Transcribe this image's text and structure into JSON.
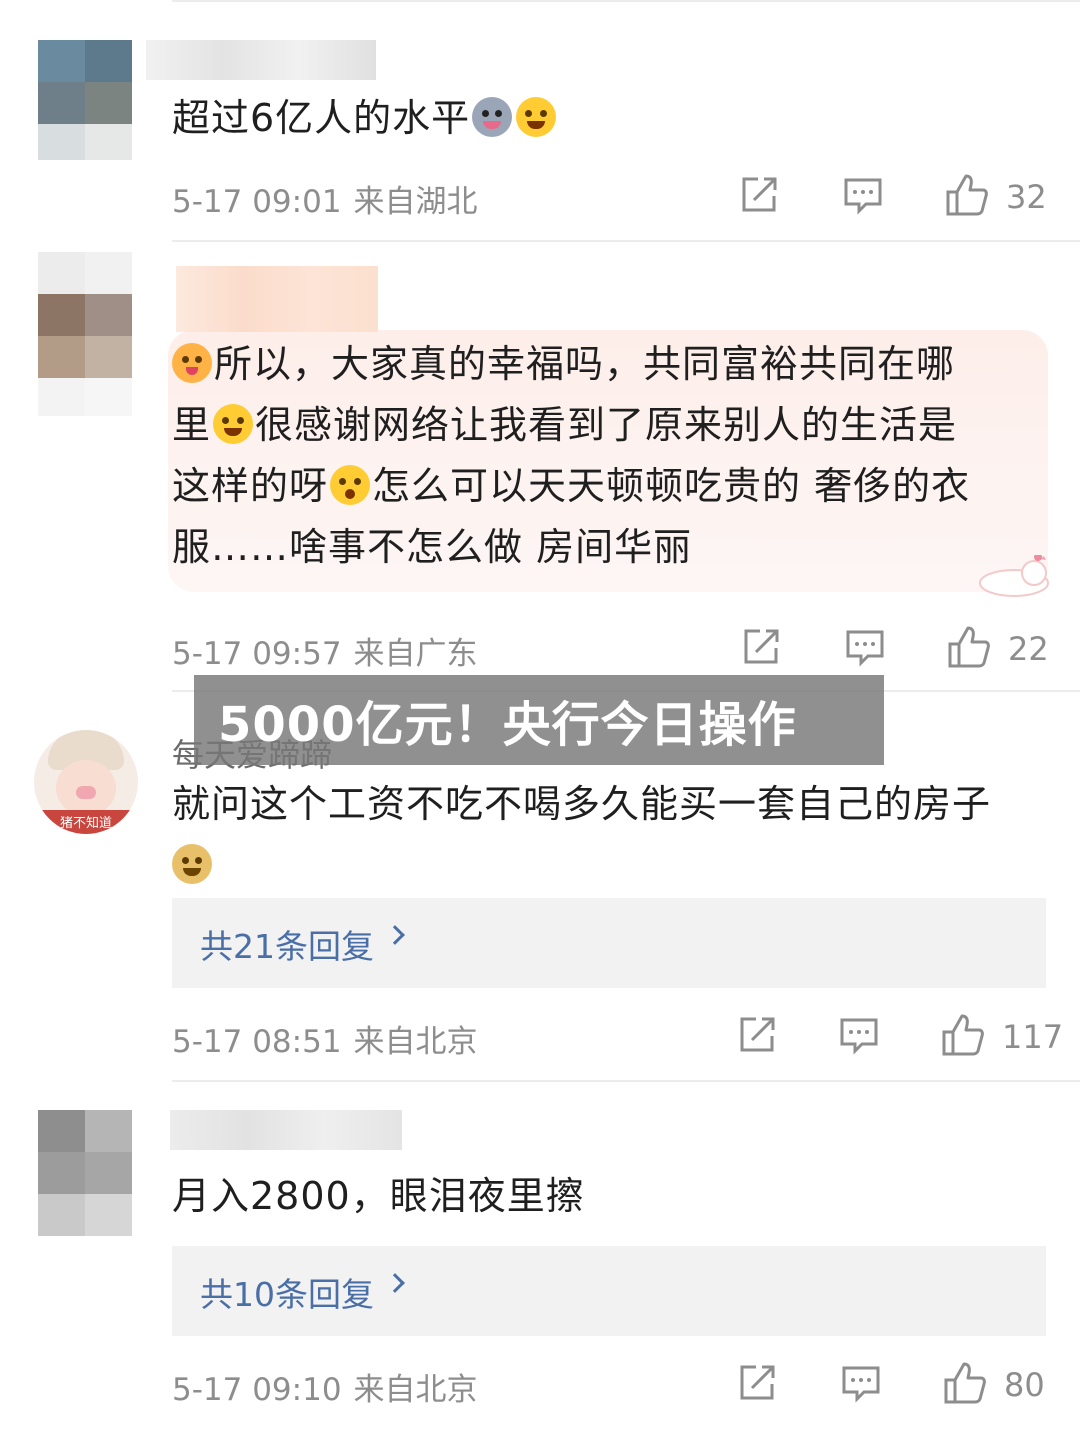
{
  "overlay": {
    "headline": "5000亿元！央行今日操作"
  },
  "comments": [
    {
      "text": "超过6亿人的水平",
      "time": "5-17 09:01",
      "location": "来自湖北",
      "likes": "32"
    },
    {
      "text_line1": "所以，大家真的幸福吗，共同富裕共同在哪",
      "text_line2_a": "里",
      "text_line2_b": "很感谢网络让我看到了原来别人的生活是",
      "text_line3_a": "这样的呀",
      "text_line3_b": "怎么可以天天顿顿吃贵的 奢侈的衣",
      "text_line4": "服……啥事不怎么做 房间华丽",
      "time": "5-17 09:57",
      "location": "来自广东",
      "likes": "22"
    },
    {
      "username": "每天爱蹄蹄",
      "avatar_caption": "猪不知道",
      "text": "就问这个工资不吃不喝多久能买一套自己的房子",
      "replies": "共21条回复",
      "time": "5-17 08:51",
      "location": "来自北京",
      "likes": "117"
    },
    {
      "text": "月入2800，眼泪夜里擦",
      "replies": "共10条回复",
      "time": "5-17 09:10",
      "location": "来自北京",
      "likes": "80"
    }
  ],
  "colors": {
    "meta": "#8d8d8d",
    "reply_link": "#4a6fa6",
    "overlay_bg": "#787878"
  },
  "icons": [
    "share-icon",
    "comment-icon",
    "like-icon",
    "chevron-right-icon"
  ]
}
